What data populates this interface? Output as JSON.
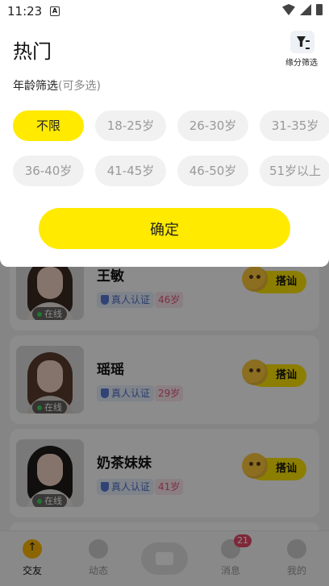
{
  "status_bar": {
    "time": "11:23",
    "notification_glyph": "A"
  },
  "sheet": {
    "title": "热门",
    "filter_button_label": "缘分筛选",
    "age_filter": {
      "label": "年龄筛选",
      "hint": "(可多选)",
      "selected": "不限",
      "options": [
        "不限",
        "18-25岁",
        "26-30岁",
        "31-35岁",
        "36-40岁",
        "41-45岁",
        "46-50岁",
        "51岁以上"
      ]
    },
    "confirm_label": "确定"
  },
  "users": [
    {
      "name": "王敏",
      "verify": "真人认证",
      "age": "46岁",
      "status": "在线",
      "action": "搭讪"
    },
    {
      "name": "瑶瑶",
      "verify": "真人认证",
      "age": "29岁",
      "status": "在线",
      "action": "搭讪"
    },
    {
      "name": "奶茶妹妹",
      "verify": "真人认证",
      "age": "41岁",
      "status": "在线",
      "action": "搭讪"
    }
  ],
  "tabbar": {
    "tabs": [
      {
        "label": "交友",
        "active": true
      },
      {
        "label": "动态"
      },
      {
        "label": "消息",
        "badge": "21"
      },
      {
        "label": "我的"
      }
    ]
  },
  "colors": {
    "accent": "#ffea00",
    "age_badge": "#e2587f",
    "verify_badge": "#4f6fc8",
    "online_dot": "#3dd65b"
  }
}
